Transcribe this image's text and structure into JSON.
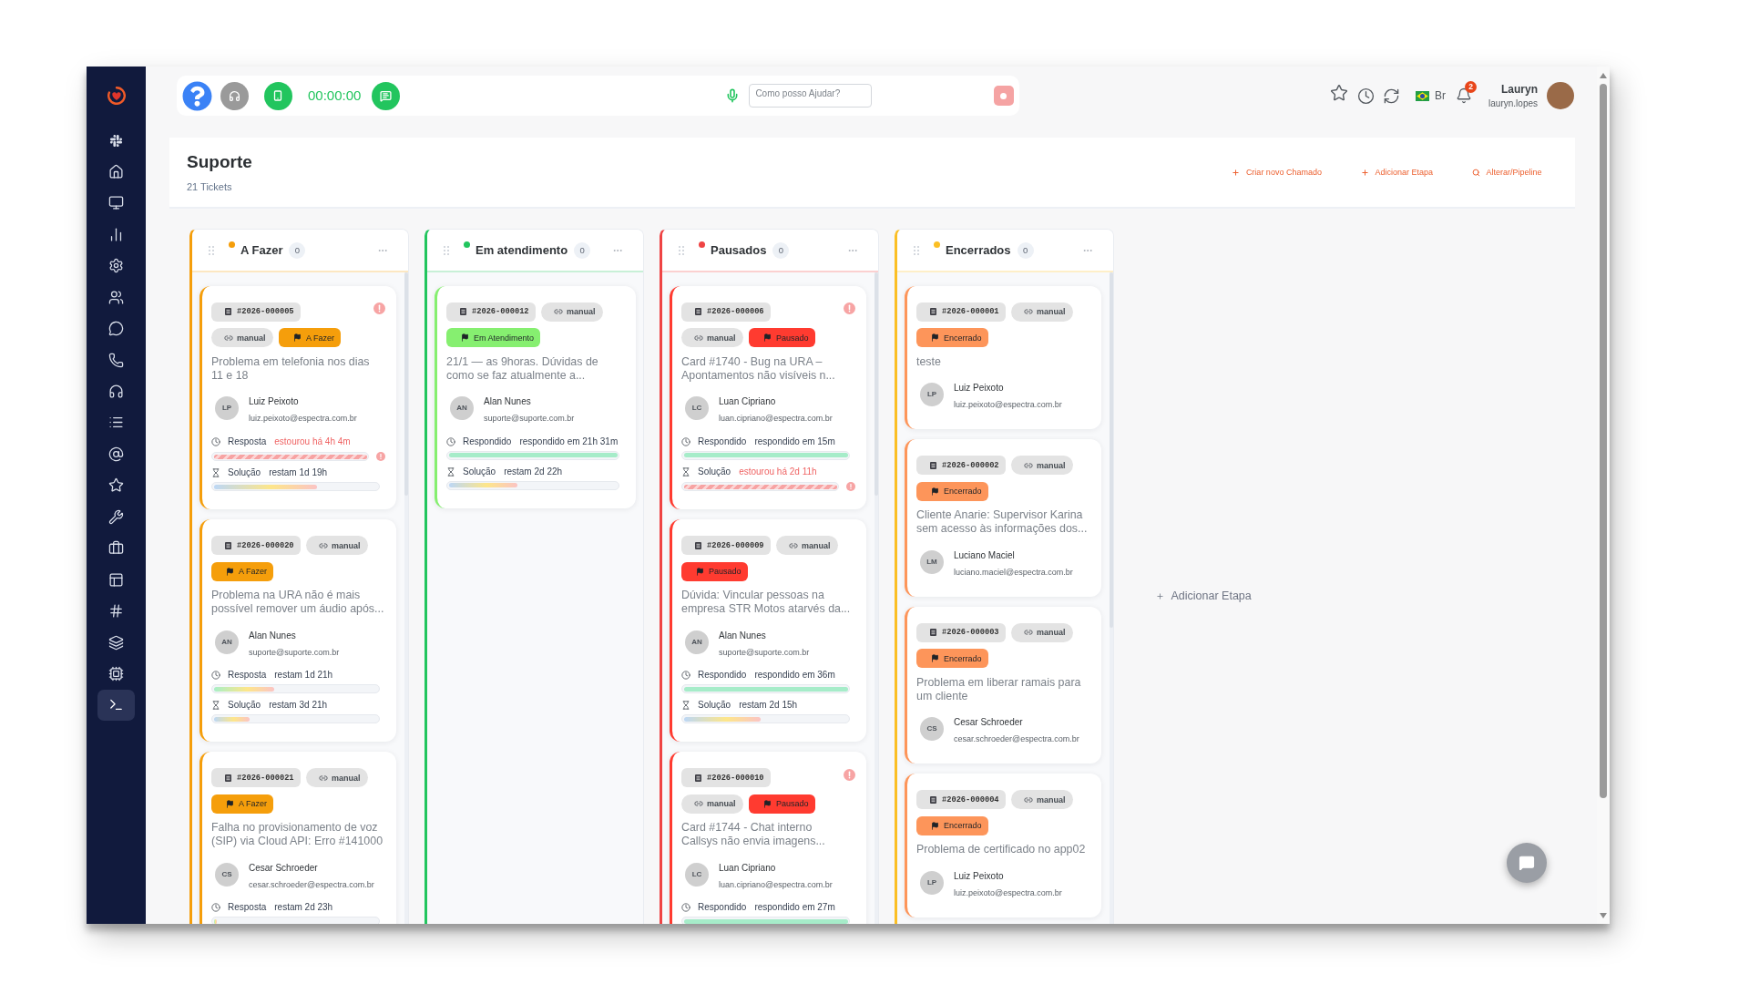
{
  "sidebar": {
    "items": [
      {
        "kind": "pinwheel",
        "selected": false
      },
      {
        "kind": "home",
        "selected": false
      },
      {
        "kind": "monitor",
        "selected": false
      },
      {
        "kind": "chart",
        "selected": false
      },
      {
        "kind": "settings",
        "selected": false
      },
      {
        "kind": "users",
        "selected": false
      },
      {
        "kind": "chat",
        "selected": false
      },
      {
        "kind": "phone",
        "selected": false
      },
      {
        "kind": "headphones",
        "selected": false
      },
      {
        "kind": "list",
        "selected": false
      },
      {
        "kind": "mention",
        "selected": false
      },
      {
        "kind": "star",
        "selected": false
      },
      {
        "kind": "wrench",
        "selected": false
      },
      {
        "kind": "briefcase",
        "selected": false
      },
      {
        "kind": "layout",
        "selected": false
      },
      {
        "kind": "hash",
        "selected": false
      },
      {
        "kind": "layers",
        "selected": false
      },
      {
        "kind": "chip",
        "selected": false
      },
      {
        "kind": "terminal",
        "selected": true
      }
    ]
  },
  "toolbar": {
    "timer": "00:00:00",
    "assistant": {
      "placeholder": "Como posso Ajudar?"
    },
    "language": "Br",
    "notifications": "2",
    "user": {
      "name": "Lauryn",
      "login": "lauryn.lopes"
    }
  },
  "board_header": {
    "title": "Suporte",
    "subtitle": "21 Tickets",
    "actions": [
      {
        "kind": "add",
        "label": "Criar novo Chamado"
      },
      {
        "kind": "add",
        "label": "Adicionar Etapa"
      },
      {
        "kind": "search",
        "label": "Alterar/Pipeline"
      }
    ]
  },
  "columns": [
    {
      "title": "A Fazer",
      "count": "0",
      "color": "#f59e0b",
      "cards": [
        {
          "ticket": "#2026-000005",
          "source": "manual",
          "alert": true,
          "status": {
            "label": "A Fazer",
            "color": "#f59e0b"
          },
          "title": "Problema em telefonia nos dias 11 e 18",
          "assignee": {
            "initials": "LP",
            "name": "Luiz Peixoto",
            "email": "luiz.peixoto@espectra.com.br"
          },
          "sla": [
            {
              "kind": "response",
              "label": "Resposta",
              "value": "estourou há 4h 4m",
              "overdue": true,
              "answered": false,
              "level": 1
            },
            {
              "kind": "solution",
              "label": "Solução",
              "value": "restam 1d 19h",
              "overdue": false,
              "answered": false,
              "level": 0.63
            }
          ]
        },
        {
          "ticket": "#2026-000020",
          "source": "manual",
          "alert": false,
          "status": {
            "label": "A Fazer",
            "color": "#f59e0b"
          },
          "title": "Problema na URA não é mais possível remover um áudio após...",
          "assignee": {
            "initials": "AN",
            "name": "Alan Nunes",
            "email": "suporte@suporte.com.br"
          },
          "sla": [
            {
              "kind": "response",
              "label": "Resposta",
              "value": "restam 1d 21h",
              "overdue": false,
              "answered": false,
              "level": 0.37
            },
            {
              "kind": "solution",
              "label": "Solução",
              "value": "restam 3d 21h",
              "overdue": false,
              "answered": false,
              "level": 0.22
            }
          ]
        },
        {
          "ticket": "#2026-000021",
          "source": "manual",
          "alert": false,
          "status": {
            "label": "A Fazer",
            "color": "#f59e0b"
          },
          "title": "Falha no provisionamento de voz (SIP) via Cloud API: Erro #141000",
          "assignee": {
            "initials": "CS",
            "name": "Cesar Schroeder",
            "email": "cesar.schroeder@espectra.com.br"
          },
          "sla": [
            {
              "kind": "response",
              "label": "Resposta",
              "value": "restam 2d 23h",
              "overdue": false,
              "answered": false,
              "level": 0.02
            }
          ]
        }
      ]
    },
    {
      "title": "Em atendimento",
      "count": "0",
      "color": "#22c55e",
      "cards": [
        {
          "ticket": "#2026-000012",
          "source": "manual",
          "alert": false,
          "status": {
            "label": "Em Atendimento",
            "color": "#86ef70"
          },
          "title": "21/1 — as 9horas. Dúvidas de como se faz atualmente a...",
          "assignee": {
            "initials": "AN",
            "name": "Alan Nunes",
            "email": "suporte@suporte.com.br"
          },
          "sla": [
            {
              "kind": "response",
              "label": "Respondido",
              "value": "respondido em 21h 31m",
              "overdue": false,
              "answered": true,
              "level": 1
            },
            {
              "kind": "solution",
              "label": "Solução",
              "value": "restam 2d 22h",
              "overdue": false,
              "answered": false,
              "level": 0.41
            }
          ]
        }
      ]
    },
    {
      "title": "Pausados",
      "count": "0",
      "color": "#ef4444",
      "cards": [
        {
          "ticket": "#2026-000006",
          "source": "manual",
          "alert": true,
          "status": {
            "label": "Pausado",
            "color": "#ff3b30"
          },
          "title": "Card #1740 - Bug na URA – Apontamentos não visíveis n...",
          "assignee": {
            "initials": "LC",
            "name": "Luan Cipriano",
            "email": "luan.cipriano@espectra.com.br"
          },
          "sla": [
            {
              "kind": "response",
              "label": "Respondido",
              "value": "respondido em 15m",
              "overdue": false,
              "answered": true,
              "level": 1
            },
            {
              "kind": "solution",
              "label": "Solução",
              "value": "estourou há 2d 11h",
              "overdue": true,
              "answered": false,
              "level": 1
            }
          ]
        },
        {
          "ticket": "#2026-000009",
          "source": "manual",
          "alert": false,
          "status": {
            "label": "Pausado",
            "color": "#ff3b30"
          },
          "title": "Dúvida: Vincular pessoas na empresa STR Motos atarvés da...",
          "assignee": {
            "initials": "AN",
            "name": "Alan Nunes",
            "email": "suporte@suporte.com.br"
          },
          "sla": [
            {
              "kind": "response",
              "label": "Respondido",
              "value": "respondido em 36m",
              "overdue": false,
              "answered": true,
              "level": 1
            },
            {
              "kind": "solution",
              "label": "Solução",
              "value": "restam 2d 15h",
              "overdue": false,
              "answered": false,
              "level": 0.47
            }
          ]
        },
        {
          "ticket": "#2026-000010",
          "source": "manual",
          "alert": true,
          "status": {
            "label": "Pausado",
            "color": "#ff3b30"
          },
          "title": "Card #1744 - Chat interno Callsys não envia imagens...",
          "assignee": {
            "initials": "LC",
            "name": "Luan Cipriano",
            "email": "luan.cipriano@espectra.com.br"
          },
          "sla": [
            {
              "kind": "response",
              "label": "Respondido",
              "value": "respondido em 27m",
              "overdue": false,
              "answered": true,
              "level": 1
            }
          ]
        }
      ]
    },
    {
      "title": "Encerrados",
      "count": "0",
      "color": "#fbbf24",
      "cards": [
        {
          "ticket": "#2026-000001",
          "source": "manual",
          "alert": false,
          "status": {
            "label": "Encerrado",
            "color": "#fd955a"
          },
          "title": "teste",
          "assignee": {
            "initials": "LP",
            "name": "Luiz Peixoto",
            "email": "luiz.peixoto@espectra.com.br"
          }
        },
        {
          "ticket": "#2026-000002",
          "source": "manual",
          "alert": false,
          "status": {
            "label": "Encerrado",
            "color": "#fd955a"
          },
          "title": "Cliente Anarie: Supervisor Karina sem acesso às informações dos...",
          "assignee": {
            "initials": "LM",
            "name": "Luciano Maciel",
            "email": "luciano.maciel@espectra.com.br"
          }
        },
        {
          "ticket": "#2026-000003",
          "source": "manual",
          "alert": false,
          "status": {
            "label": "Encerrado",
            "color": "#fd955a"
          },
          "title": "Problema em liberar ramais para um cliente",
          "assignee": {
            "initials": "CS",
            "name": "Cesar Schroeder",
            "email": "cesar.schroeder@espectra.com.br"
          }
        },
        {
          "ticket": "#2026-000004",
          "source": "manual",
          "alert": false,
          "status": {
            "label": "Encerrado",
            "color": "#fd955a"
          },
          "title": "Problema de certificado no app02",
          "assignee": {
            "initials": "LP",
            "name": "Luiz Peixoto",
            "email": "luiz.peixoto@espectra.com.br"
          }
        }
      ]
    }
  ],
  "add_stage": {
    "label": "Adicionar Etapa"
  }
}
